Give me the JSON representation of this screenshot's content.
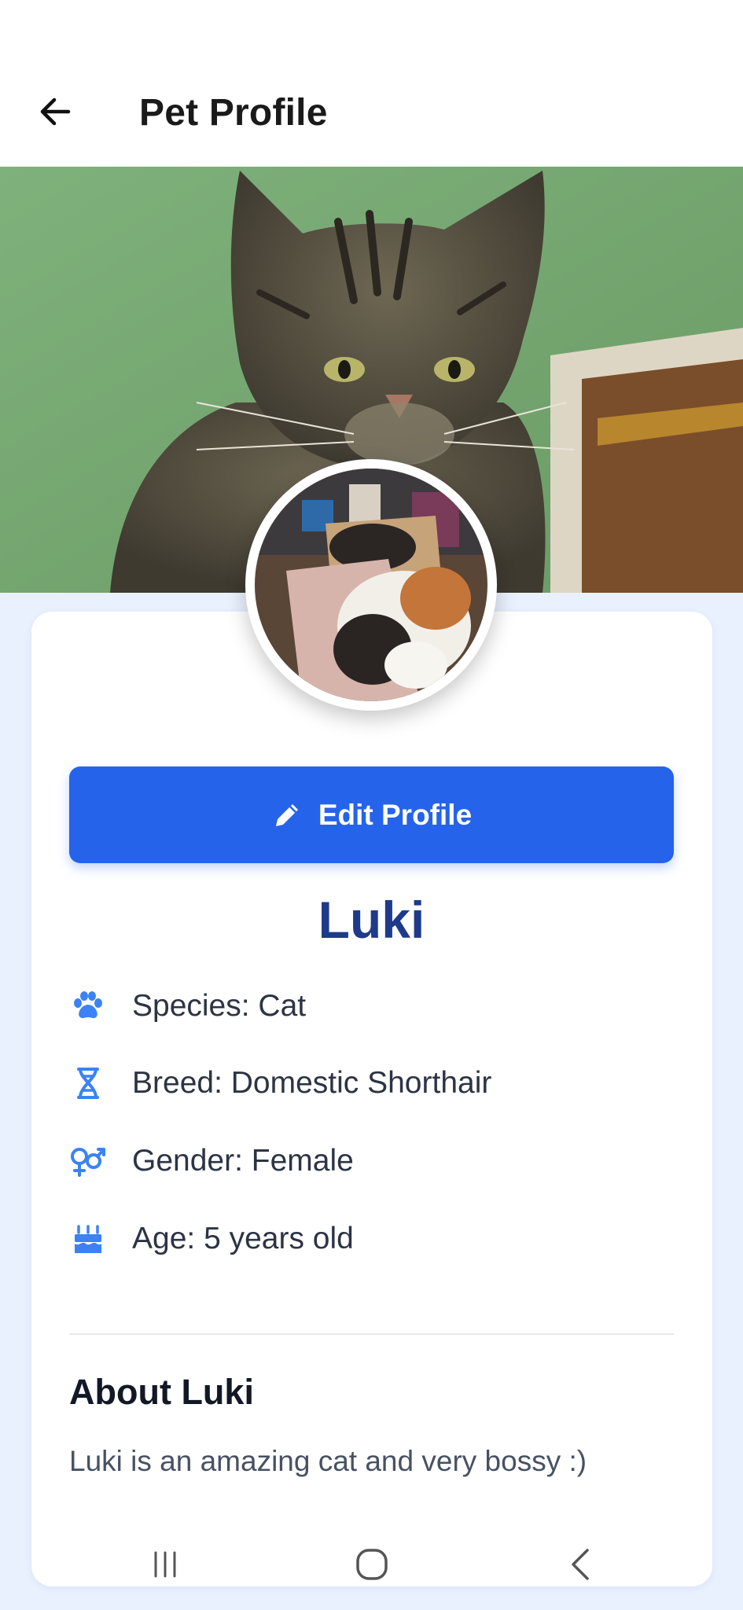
{
  "header": {
    "title": "Pet Profile",
    "back_icon": "arrow-left-icon"
  },
  "edit_button": {
    "label": "Edit Profile",
    "icon": "pencil-icon"
  },
  "pet": {
    "name": "Luki",
    "details": [
      {
        "icon": "paw-icon",
        "text": "Species: Cat"
      },
      {
        "icon": "dna-icon",
        "text": "Breed: Domestic Shorthair"
      },
      {
        "icon": "gender-icon",
        "text": "Gender: Female"
      },
      {
        "icon": "birthday-cake-icon",
        "text": "Age: 5 years old"
      }
    ]
  },
  "about": {
    "title": "About Luki",
    "text": "Luki is an amazing cat and very bossy :)"
  },
  "colors": {
    "primary": "#2563eb",
    "name": "#1e3a8a",
    "icon": "#3b82f6",
    "page_bg": "#eaf1fe"
  }
}
